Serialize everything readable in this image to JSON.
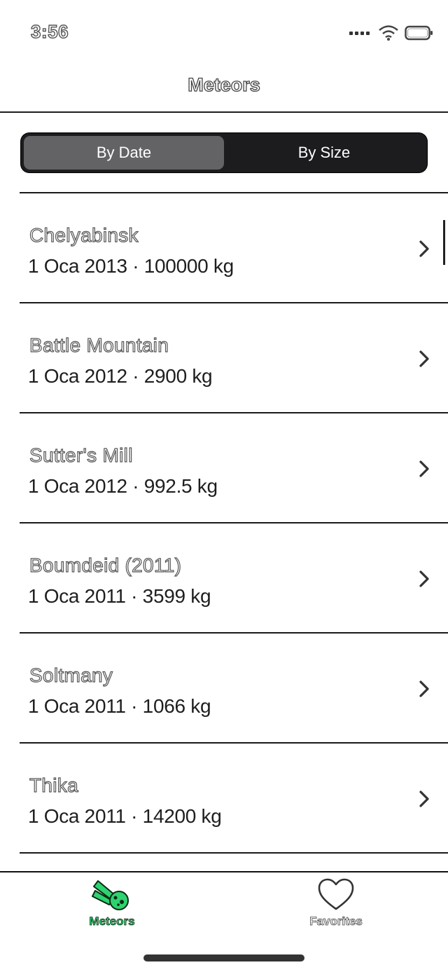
{
  "status_bar": {
    "time": "3:56",
    "icons": [
      "signal-icon",
      "wifi-icon",
      "battery-icon"
    ]
  },
  "nav": {
    "title": "Meteors"
  },
  "segmented": {
    "options": [
      "By Date",
      "By Size"
    ],
    "selected": "By Date"
  },
  "meteors": [
    {
      "name": "Chelyabinsk",
      "detail": "1 Oca 2013 · 100000 kg"
    },
    {
      "name": "Battle Mountain",
      "detail": "1 Oca 2012 · 2900 kg"
    },
    {
      "name": "Sutter's Mill",
      "detail": "1 Oca 2012 · 992.5 kg"
    },
    {
      "name": "Boumdeid (2011)",
      "detail": "1 Oca 2011 · 3599 kg"
    },
    {
      "name": "Soltmany",
      "detail": "1 Oca 2011 · 1066 kg"
    },
    {
      "name": "Thika",
      "detail": "1 Oca 2011 · 14200 kg"
    }
  ],
  "tabs": [
    {
      "label": "Meteors",
      "icon": "meteor-icon",
      "active": true
    },
    {
      "label": "Favorites",
      "icon": "heart-icon",
      "active": false
    }
  ],
  "colors": {
    "accent": "#2dd36f",
    "segment_bg": "#1c1c1e",
    "segment_selected": "#636366"
  }
}
